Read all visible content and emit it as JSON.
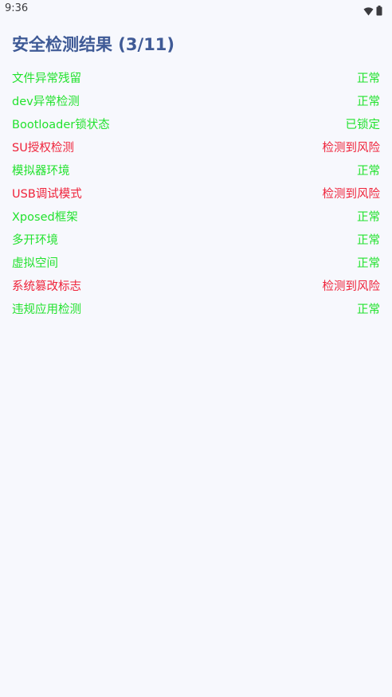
{
  "status_bar": {
    "time": "9:36",
    "icons": [
      "wifi-icon",
      "battery-icon"
    ]
  },
  "title": "安全检测结果 (3/11)",
  "colors": {
    "title": "#3f5a96",
    "ok": "#22e22e",
    "risk": "#ef233a",
    "background": "#f7f8fd"
  },
  "items": [
    {
      "label": "文件异常残留",
      "status": "正常",
      "state": "ok"
    },
    {
      "label": "dev异常检测",
      "status": "正常",
      "state": "ok"
    },
    {
      "label": "Bootloader锁状态",
      "status": "已锁定",
      "state": "ok"
    },
    {
      "label": "SU授权检测",
      "status": "检测到风险",
      "state": "risk"
    },
    {
      "label": "模拟器环境",
      "status": "正常",
      "state": "ok"
    },
    {
      "label": "USB调试模式",
      "status": "检测到风险",
      "state": "risk"
    },
    {
      "label": "Xposed框架",
      "status": "正常",
      "state": "ok"
    },
    {
      "label": "多开环境",
      "status": "正常",
      "state": "ok"
    },
    {
      "label": "虚拟空间",
      "status": "正常",
      "state": "ok"
    },
    {
      "label": "系统篡改标志",
      "status": "检测到风险",
      "state": "risk"
    },
    {
      "label": "违规应用检测",
      "status": "正常",
      "state": "ok"
    }
  ]
}
